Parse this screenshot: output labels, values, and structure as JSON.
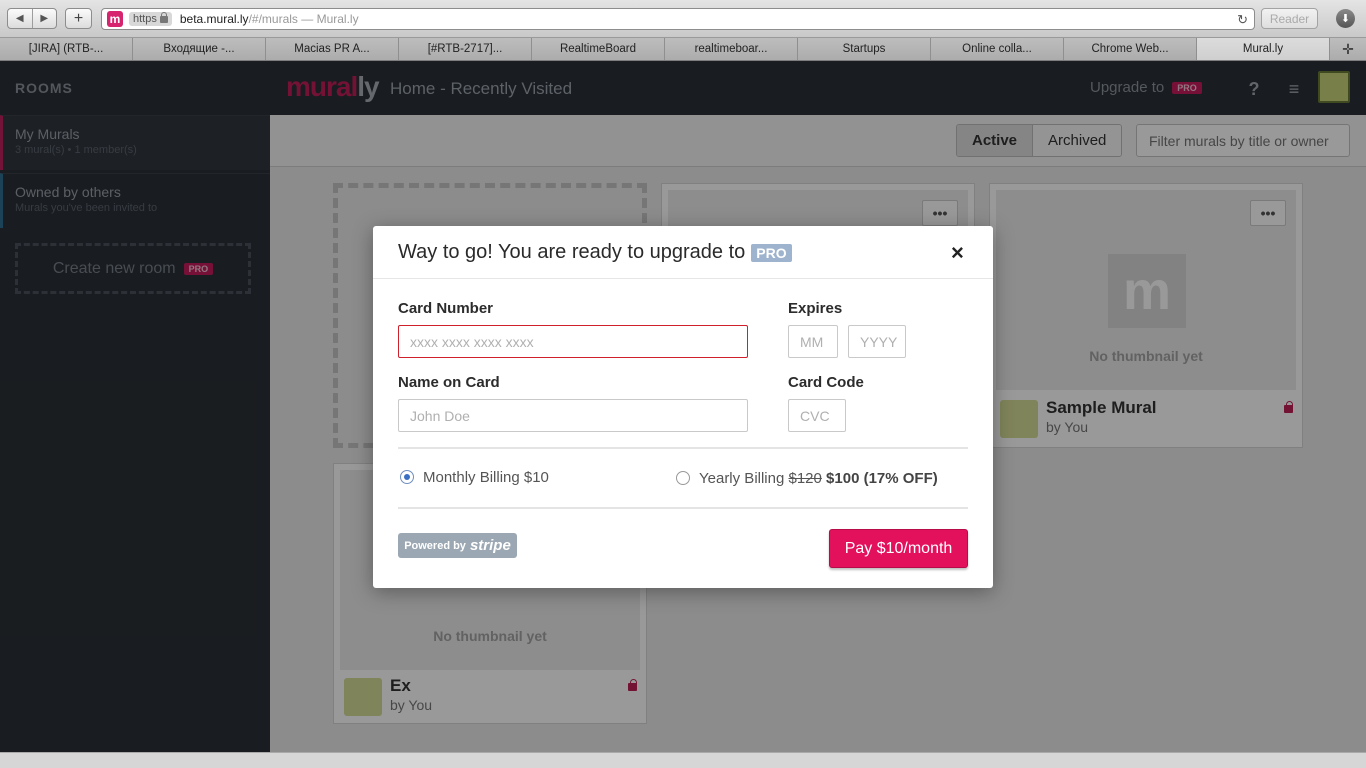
{
  "browser": {
    "back": "◀",
    "forward": "▶",
    "new_tab": "+",
    "https": "https",
    "url_host": "beta.mural.ly",
    "url_path": "/#/murals",
    "page_title_sep": " — Mural.ly",
    "reader": "Reader",
    "tabs": [
      {
        "label": "[JIRA] (RTB-..."
      },
      {
        "label": "Входящие -..."
      },
      {
        "label": "Macias PR A..."
      },
      {
        "label": "[#RTB-2717]..."
      },
      {
        "label": "RealtimeBoard"
      },
      {
        "label": "realtimeboar..."
      },
      {
        "label": "Startups"
      },
      {
        "label": "Online colla..."
      },
      {
        "label": "Chrome Web..."
      },
      {
        "label": "Mural.ly"
      }
    ]
  },
  "sidebar": {
    "title": "ROOMS",
    "rooms": [
      {
        "name": "My Murals",
        "sub": "3 mural(s) • 1 member(s)"
      },
      {
        "name": "Owned by others",
        "sub": "Murals you've been invited to"
      }
    ],
    "create_room": "Create new room",
    "pro": "PRO"
  },
  "topbar": {
    "logo_a": "mural",
    "logo_b": "ly",
    "page_title": "Home - Recently Visited",
    "upgrade_label": "Upgrade to",
    "upgrade_pro": "PRO",
    "help": "?",
    "menu": "≡"
  },
  "filters": {
    "active": "Active",
    "archived": "Archived",
    "search_placeholder": "Filter murals by title or owner"
  },
  "murals": [
    {
      "title": "Sample Mural",
      "by": "by You",
      "no_thumb": "No thumbnail yet",
      "menu": "•••"
    },
    {
      "title": "Ex",
      "by": "by You",
      "no_thumb": "No thumbnail yet"
    }
  ],
  "modal": {
    "title": "Way to go! You are ready to upgrade to",
    "pro": "PRO",
    "close": "×",
    "card_number_label": "Card Number",
    "card_number_placeholder": "xxxx xxxx xxxx xxxx",
    "expires_label": "Expires",
    "mm_placeholder": "MM",
    "yyyy_placeholder": "YYYY",
    "name_label": "Name on Card",
    "name_placeholder": "John Doe",
    "code_label": "Card Code",
    "cvc_placeholder": "CVC",
    "monthly_label": "Monthly Billing $10",
    "yearly_label": "Yearly Billing",
    "yearly_old_price": "$120",
    "yearly_new_price": "$100 (17% OFF)",
    "selected_plan": "monthly",
    "powered_by": "Powered by",
    "stripe": "stripe",
    "pay_button": "Pay $10/month"
  },
  "colors": {
    "accent": "#e3105c",
    "error_border": "#d0202b",
    "pro_badge": "#9eb3cd"
  }
}
